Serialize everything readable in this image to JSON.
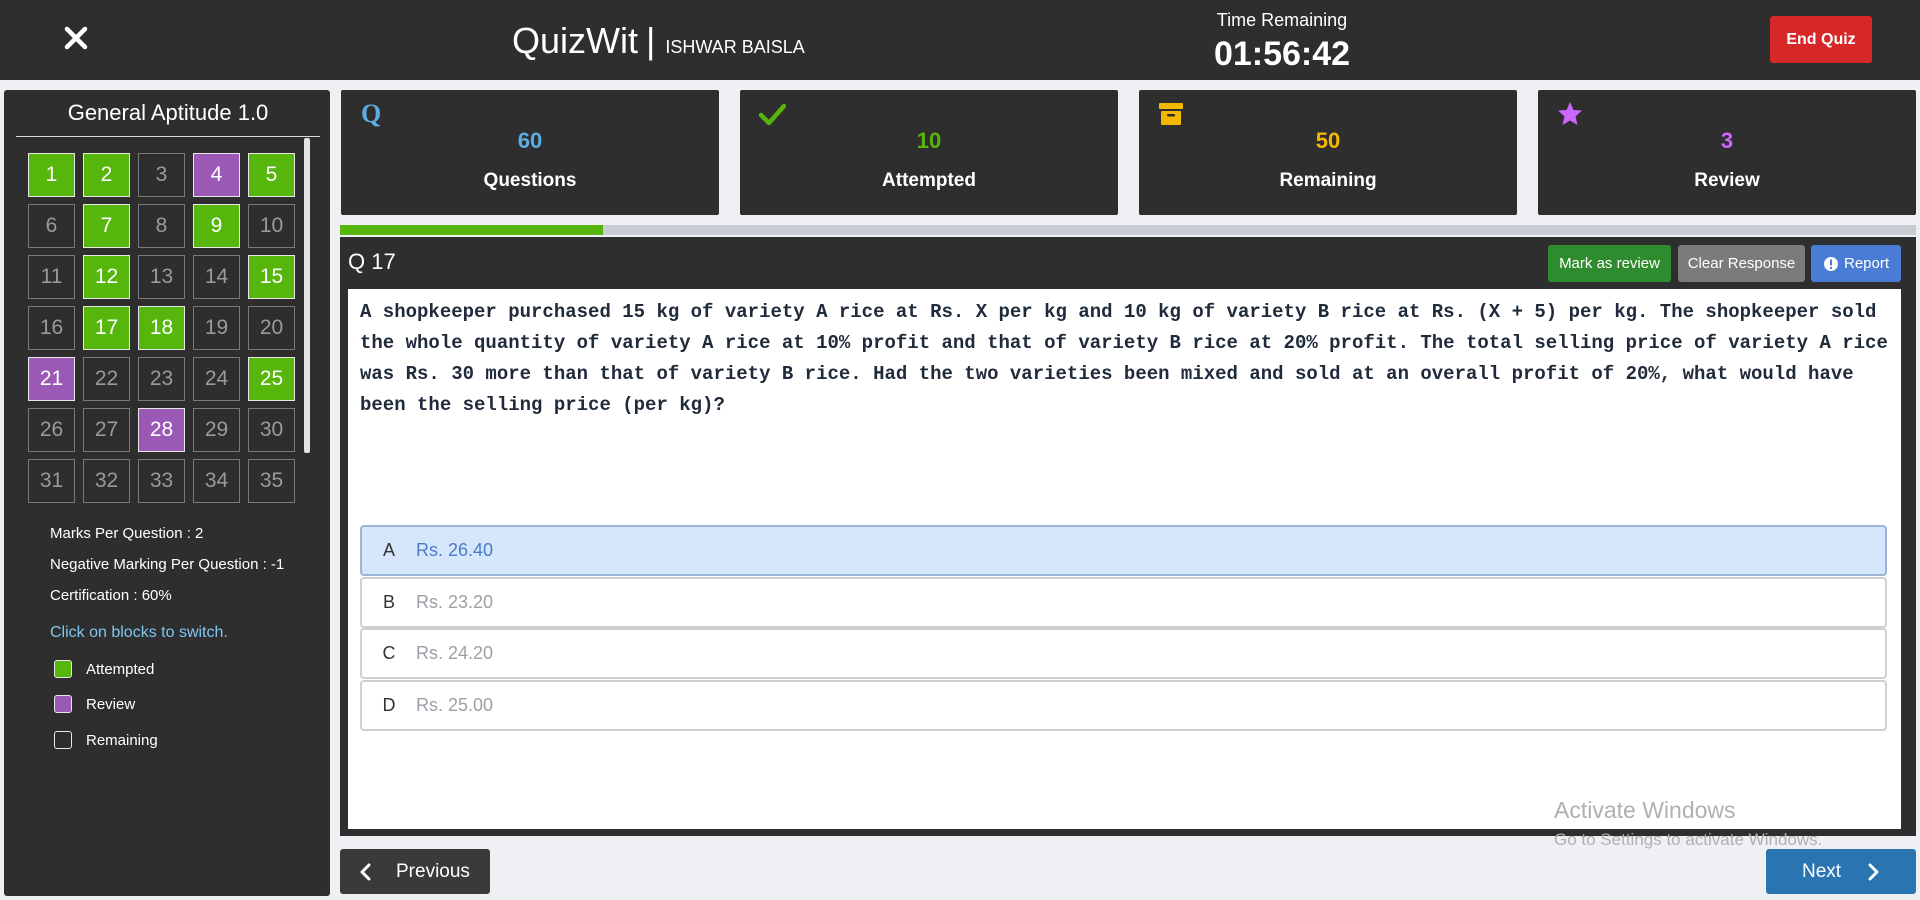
{
  "header": {
    "app_name": "QuizWit",
    "separator": "|",
    "user_name": "ISHWAR BAISLA",
    "timer_label": "Time Remaining",
    "timer_value": "01:56:42",
    "end_quiz_label": "End Quiz"
  },
  "sidebar": {
    "title": "General Aptitude 1.0",
    "questions": [
      {
        "n": "1",
        "status": "attempted"
      },
      {
        "n": "2",
        "status": "attempted"
      },
      {
        "n": "3",
        "status": "remaining"
      },
      {
        "n": "4",
        "status": "review"
      },
      {
        "n": "5",
        "status": "attempted"
      },
      {
        "n": "6",
        "status": "remaining"
      },
      {
        "n": "7",
        "status": "attempted"
      },
      {
        "n": "8",
        "status": "remaining"
      },
      {
        "n": "9",
        "status": "attempted"
      },
      {
        "n": "10",
        "status": "remaining"
      },
      {
        "n": "11",
        "status": "remaining"
      },
      {
        "n": "12",
        "status": "attempted"
      },
      {
        "n": "13",
        "status": "remaining"
      },
      {
        "n": "14",
        "status": "remaining"
      },
      {
        "n": "15",
        "status": "attempted"
      },
      {
        "n": "16",
        "status": "remaining"
      },
      {
        "n": "17",
        "status": "attempted"
      },
      {
        "n": "18",
        "status": "attempted"
      },
      {
        "n": "19",
        "status": "remaining"
      },
      {
        "n": "20",
        "status": "remaining"
      },
      {
        "n": "21",
        "status": "review"
      },
      {
        "n": "22",
        "status": "remaining"
      },
      {
        "n": "23",
        "status": "remaining"
      },
      {
        "n": "24",
        "status": "remaining"
      },
      {
        "n": "25",
        "status": "attempted"
      },
      {
        "n": "26",
        "status": "remaining"
      },
      {
        "n": "27",
        "status": "remaining"
      },
      {
        "n": "28",
        "status": "review"
      },
      {
        "n": "29",
        "status": "remaining"
      },
      {
        "n": "30",
        "status": "remaining"
      },
      {
        "n": "31",
        "status": "remaining"
      },
      {
        "n": "32",
        "status": "remaining"
      },
      {
        "n": "33",
        "status": "remaining"
      },
      {
        "n": "34",
        "status": "remaining"
      },
      {
        "n": "35",
        "status": "remaining"
      }
    ],
    "marks_per_question": "Marks Per Question : 2",
    "negative_marking": "Negative Marking Per Question : -1",
    "certification": "Certification : 60%",
    "hint": "Click on blocks to switch.",
    "legend": {
      "attempted": "Attempted",
      "review": "Review",
      "remaining": "Remaining"
    }
  },
  "stats": {
    "questions": {
      "value": "60",
      "label": "Questions",
      "icon": "q-icon"
    },
    "attempted": {
      "value": "10",
      "label": "Attempted",
      "icon": "check-icon"
    },
    "remaining": {
      "value": "50",
      "label": "Remaining",
      "icon": "archive-icon"
    },
    "review": {
      "value": "3",
      "label": "Review",
      "icon": "star-icon"
    }
  },
  "progress": {
    "fraction": 0.1667
  },
  "question": {
    "number_label": "Q 17",
    "mark_review_label": "Mark as review",
    "clear_response_label": "Clear Response",
    "report_label": "Report",
    "text": "A shopkeeper purchased 15 kg of variety A rice at Rs. X per kg and 10 kg of variety B rice at Rs. (X + 5) per kg. The shopkeeper sold the whole quantity of variety A rice at 10% profit and that of variety B rice at 20% profit. The total selling price of variety A rice was Rs. 30 more than that of variety B rice. Had the two varieties been mixed and sold at an overall profit of 20%, what would have been the selling price (per kg)?",
    "options": [
      {
        "letter": "A",
        "value": "Rs. 26.40",
        "selected": true
      },
      {
        "letter": "B",
        "value": "Rs. 23.20",
        "selected": false
      },
      {
        "letter": "C",
        "value": "Rs. 24.20",
        "selected": false
      },
      {
        "letter": "D",
        "value": "Rs. 25.00",
        "selected": false
      }
    ]
  },
  "nav": {
    "previous_label": "Previous",
    "next_label": "Next"
  },
  "watermark": {
    "line1": "Activate Windows",
    "line2": "Go to Settings to activate Windows."
  },
  "colors": {
    "attempted": "#56b60b",
    "review": "#9b59b6",
    "questions_stat": "#5dade2",
    "remaining_stat": "#f5b800",
    "review_stat": "#cc66ff",
    "end_quiz": "#d62828",
    "mark_review_btn": "#2e8b2e",
    "clear_btn": "#7b7b7b",
    "report_btn": "#4a7cd6",
    "nav_btn": "#3a3a3a",
    "next_btn": "#2a74b2"
  }
}
